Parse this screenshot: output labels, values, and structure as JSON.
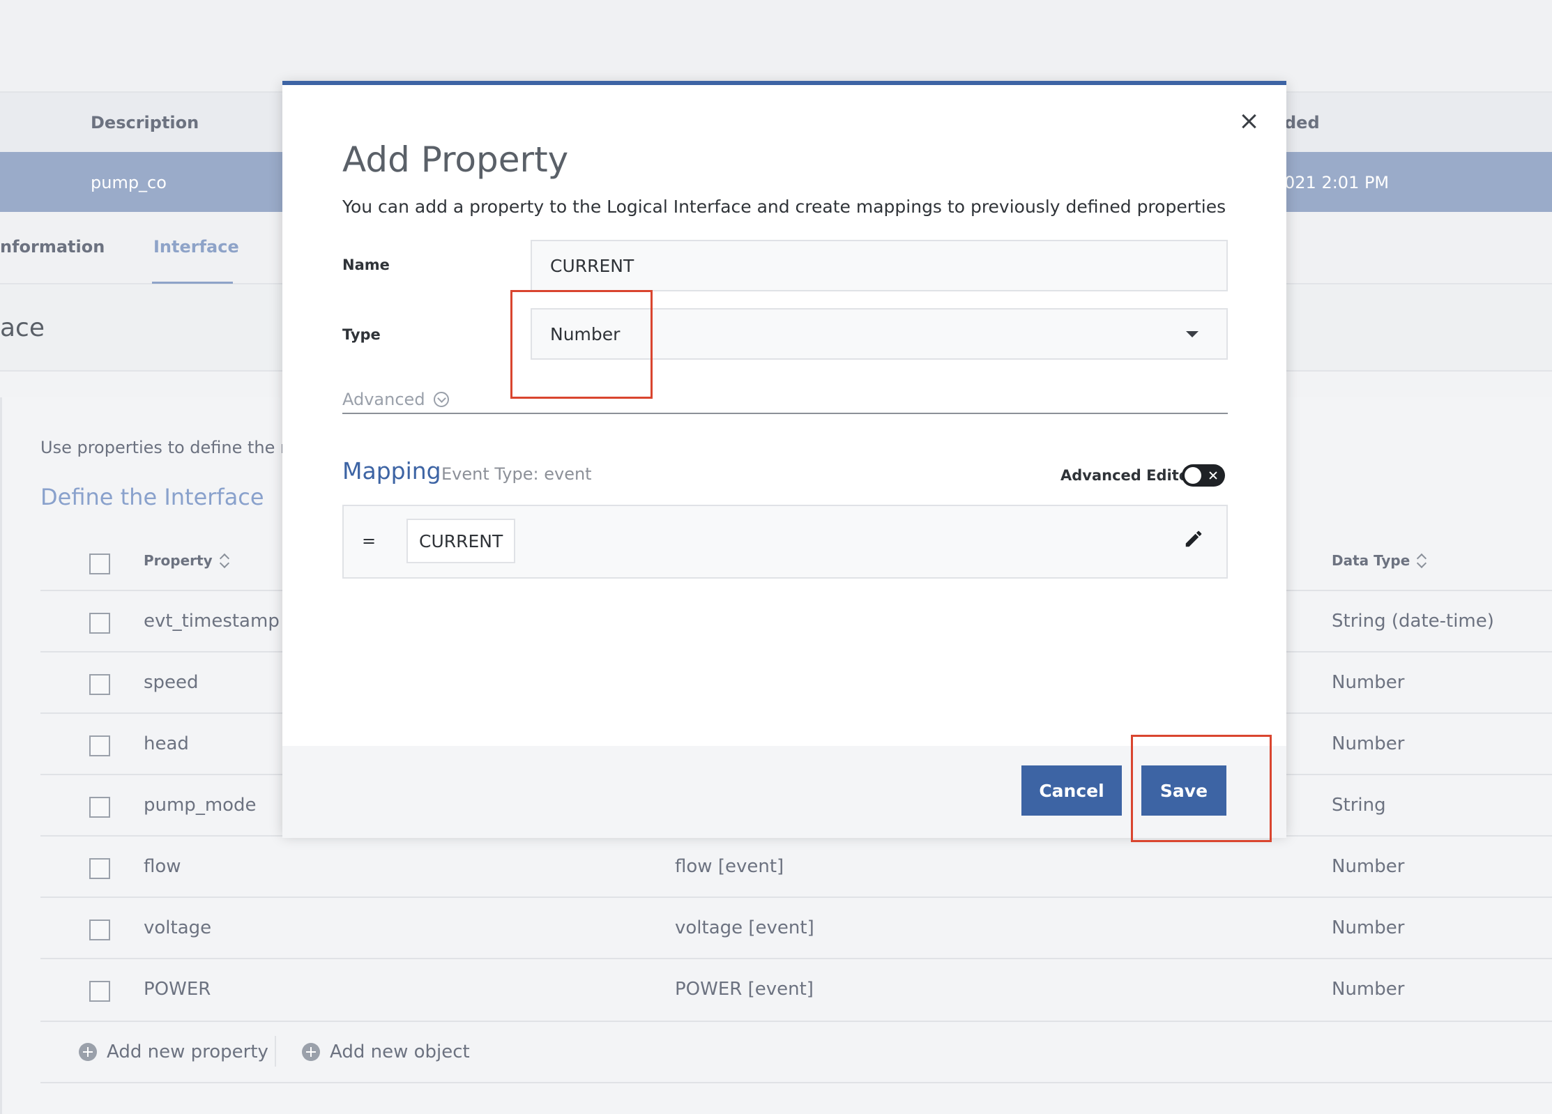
{
  "background": {
    "table_header": {
      "description": "Description",
      "added": "ded"
    },
    "selected_row": {
      "description": "pump_co",
      "date": "021 2:01 PM"
    },
    "tabs": {
      "information": "nformation",
      "interface": "Interface"
    },
    "section_title": "ace",
    "help_text": "Use properties to define the ma",
    "define_title": "Define the Interface",
    "columns": {
      "property": "Property",
      "data_type": "Data Type"
    },
    "rows": [
      {
        "property": "evt_timestamp",
        "mapping": "",
        "data_type": "String (date-time)"
      },
      {
        "property": "speed",
        "mapping": "",
        "data_type": "Number"
      },
      {
        "property": "head",
        "mapping": "",
        "data_type": "Number"
      },
      {
        "property": "pump_mode",
        "mapping": "",
        "data_type": "String"
      },
      {
        "property": "flow",
        "mapping": "flow [event]",
        "data_type": "Number"
      },
      {
        "property": "voltage",
        "mapping": "voltage [event]",
        "data_type": "Number"
      },
      {
        "property": "POWER",
        "mapping": "POWER [event]",
        "data_type": "Number"
      }
    ],
    "add_property": "Add new property",
    "add_object": "Add new object"
  },
  "modal": {
    "title": "Add Property",
    "subtitle": "You can add a property to the Logical Interface and create mappings to previously defined properties",
    "name_label": "Name",
    "name_value": "CURRENT",
    "type_label": "Type",
    "type_value": "Number",
    "advanced_label": "Advanced",
    "mapping_title": "Mapping",
    "mapping_event_type": "Event Type: event",
    "advanced_editor_label": "Advanced Editor",
    "advanced_editor_on": false,
    "mapping_operator": "=",
    "mapping_token": "CURRENT",
    "cancel_label": "Cancel",
    "save_label": "Save"
  },
  "colors": {
    "accent": "#3d64a4",
    "selected_row": "#9aabc9",
    "highlight": "#d9452f"
  },
  "icons": [
    "close-icon",
    "caret-down-icon",
    "chevron-circle-down-icon",
    "toggle-x-icon",
    "pencil-icon",
    "sort-icon",
    "add-circle-icon"
  ]
}
